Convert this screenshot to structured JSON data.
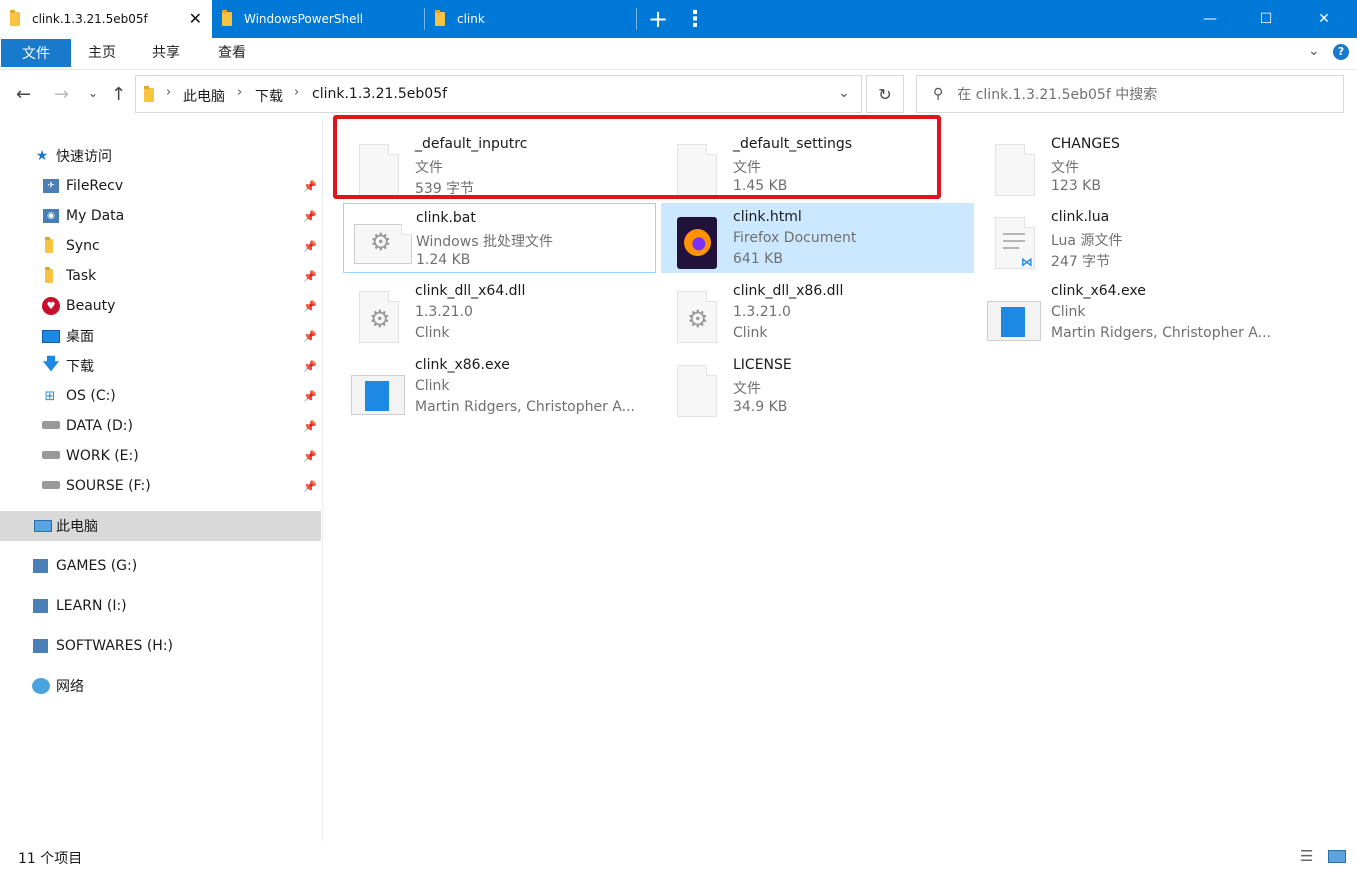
{
  "tabs": [
    {
      "label": "clink.1.3.21.5eb05f"
    },
    {
      "label": "WindowsPowerShell"
    },
    {
      "label": "clink"
    }
  ],
  "window": {
    "new_tab": "+",
    "more": "⋮",
    "minimize": "—",
    "maximize": "☐",
    "close": "✕"
  },
  "ribbon": {
    "file": "文件",
    "home": "主页",
    "share": "共享",
    "view": "查看"
  },
  "address": {
    "crumbs": [
      "此电脑",
      "下载",
      "clink.1.3.21.5eb05f"
    ],
    "search_placeholder": "在 clink.1.3.21.5eb05f 中搜索"
  },
  "sidebar": {
    "quick_access": "快速访问",
    "items": [
      {
        "label": "FileRecv",
        "icon": "filerecv-folder-icon"
      },
      {
        "label": "My Data",
        "icon": "mydata-folder-icon"
      },
      {
        "label": "Sync",
        "icon": "folder-icon"
      },
      {
        "label": "Task",
        "icon": "folder-icon"
      },
      {
        "label": "Beauty",
        "icon": "heart-icon"
      },
      {
        "label": "桌面",
        "icon": "desktop-icon"
      },
      {
        "label": "下载",
        "icon": "download-icon"
      },
      {
        "label": "OS (C:)",
        "icon": "windows-drive-icon"
      },
      {
        "label": "DATA (D:)",
        "icon": "drive-icon"
      },
      {
        "label": "WORK (E:)",
        "icon": "drive-icon"
      },
      {
        "label": "SOURSE (F:)",
        "icon": "drive-icon"
      }
    ],
    "this_pc": "此电脑",
    "drives": [
      {
        "label": "GAMES (G:)"
      },
      {
        "label": "LEARN (I:)"
      },
      {
        "label": "SOFTWARES (H:)"
      }
    ],
    "network": "网络"
  },
  "files": [
    {
      "name": "_default_inputrc",
      "l2": "文件",
      "l3": "539 字节",
      "icon": "blank-doc"
    },
    {
      "name": "_default_settings",
      "l2": "文件",
      "l3": "1.45 KB",
      "icon": "blank-doc"
    },
    {
      "name": "CHANGES",
      "l2": "文件",
      "l3": "123 KB",
      "icon": "blank-doc"
    },
    {
      "name": "clink.bat",
      "l2": "Windows 批处理文件",
      "l3": "1.24 KB",
      "icon": "gear-doc"
    },
    {
      "name": "clink.html",
      "l2": "Firefox Document",
      "l3": "641 KB",
      "icon": "firefox"
    },
    {
      "name": "clink.lua",
      "l2": "Lua 源文件",
      "l3": "247 字节",
      "icon": "vscode-doc"
    },
    {
      "name": "clink_dll_x64.dll",
      "l2": "1.3.21.0",
      "l3": "Clink",
      "icon": "gear-doc"
    },
    {
      "name": "clink_dll_x86.dll",
      "l2": "1.3.21.0",
      "l3": "Clink",
      "icon": "gear-doc"
    },
    {
      "name": "clink_x64.exe",
      "l2": "Clink",
      "l3": "Martin Ridgers, Christopher A...",
      "icon": "exe"
    },
    {
      "name": "clink_x86.exe",
      "l2": "Clink",
      "l3": "Martin Ridgers, Christopher A...",
      "icon": "exe"
    },
    {
      "name": "LICENSE",
      "l2": "文件",
      "l3": "34.9 KB",
      "icon": "blank-doc"
    }
  ],
  "status": {
    "count": "11 个项目"
  },
  "colors": {
    "accent": "#0078d7",
    "highlight_box": "#e0141e",
    "selected": "#cce8ff"
  }
}
